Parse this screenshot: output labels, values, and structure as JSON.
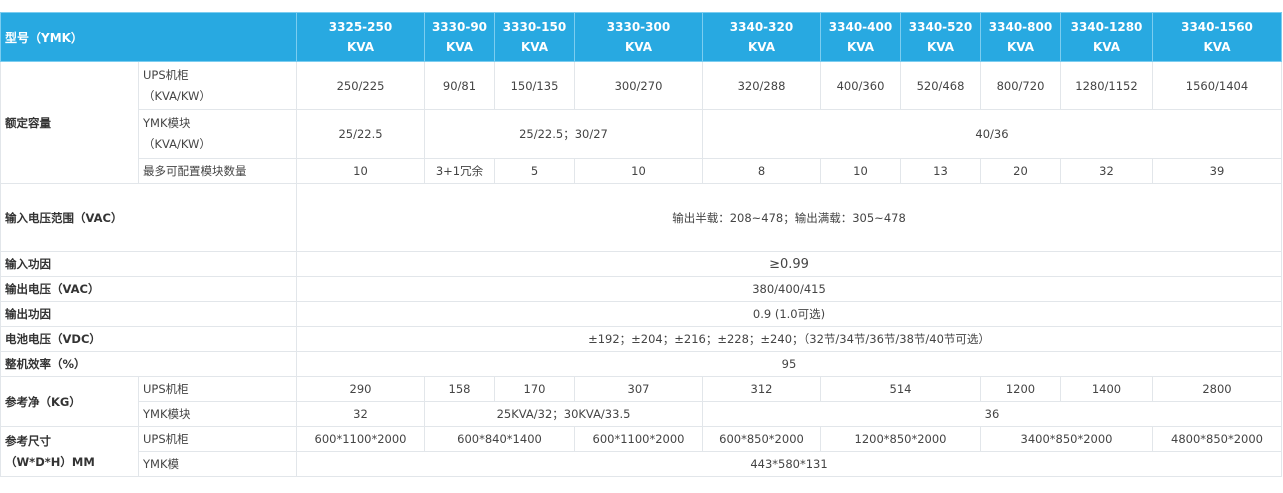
{
  "header": {
    "label": "型号（YMK）",
    "models": [
      {
        "l1": "3325-250",
        "l2": "KVA"
      },
      {
        "l1": "3330-90",
        "l2": "KVA"
      },
      {
        "l1": "3330-150",
        "l2": "KVA"
      },
      {
        "l1": "3330-300",
        "l2": "KVA"
      },
      {
        "l1": "3340-320",
        "l2": "KVA"
      },
      {
        "l1": "3340-400",
        "l2": "KVA"
      },
      {
        "l1": "3340-520",
        "l2": "KVA"
      },
      {
        "l1": "3340-800",
        "l2": "KVA"
      },
      {
        "l1": "3340-1280",
        "l2": "KVA"
      },
      {
        "l1": "3340-1560",
        "l2": "KVA"
      }
    ]
  },
  "rated": {
    "group": "额定容量",
    "ups_label_1": "UPS机柜",
    "ups_label_2": "（KVA/KW）",
    "ups_values": [
      "250/225",
      "90/81",
      "150/135",
      "300/270",
      "320/288",
      "400/360",
      "520/468",
      "800/720",
      "1280/1152",
      "1560/1404"
    ],
    "ymk_label_1": "YMK模块",
    "ymk_label_2": "（KVA/KW）",
    "ymk_values": [
      "25/22.5",
      "25/22.5；30/27",
      "40/36"
    ],
    "max_label": "最多可配置模块数量",
    "max_values": [
      "10",
      "3+1冗余",
      "5",
      "10",
      "8",
      "10",
      "13",
      "20",
      "32",
      "39"
    ]
  },
  "input_voltage": {
    "label": "输入电压范围（VAC）",
    "value": "输出半载：208~478；输出满载：305~478"
  },
  "input_pf": {
    "label": "输入功因",
    "value": "≥0.99"
  },
  "output_voltage": {
    "label": "输出电压（VAC）",
    "value": "380/400/415"
  },
  "output_pf": {
    "label": "输出功因",
    "value": "0.9 (1.0可选)"
  },
  "battery_voltage": {
    "label": "电池电压（VDC）",
    "value": "±192；±204；±216；±228；±240；（32节/34节/36节/38节/40节可选）"
  },
  "efficiency": {
    "label": "整机效率（%）",
    "value": "95"
  },
  "weight": {
    "group": "参考净（KG）",
    "ups_label": "UPS机柜",
    "ups_values": [
      "290",
      "158",
      "170",
      "307",
      "312",
      "514",
      "1200",
      "1400",
      "2800"
    ],
    "ymk_label": "YMK模块",
    "ymk_values": [
      "32",
      "25KVA/32；30KVA/33.5",
      "36"
    ]
  },
  "dimensions": {
    "group_1": "参考尺寸",
    "group_2": "（W*D*H）MM",
    "ups_label": "UPS机柜",
    "ups_values": [
      "600*1100*2000",
      "600*840*1400",
      "600*1100*2000",
      "600*850*2000",
      "1200*850*2000",
      "3400*850*2000",
      "4800*850*2000"
    ],
    "ymk_label": "YMK模",
    "ymk_value": "443*580*131"
  }
}
